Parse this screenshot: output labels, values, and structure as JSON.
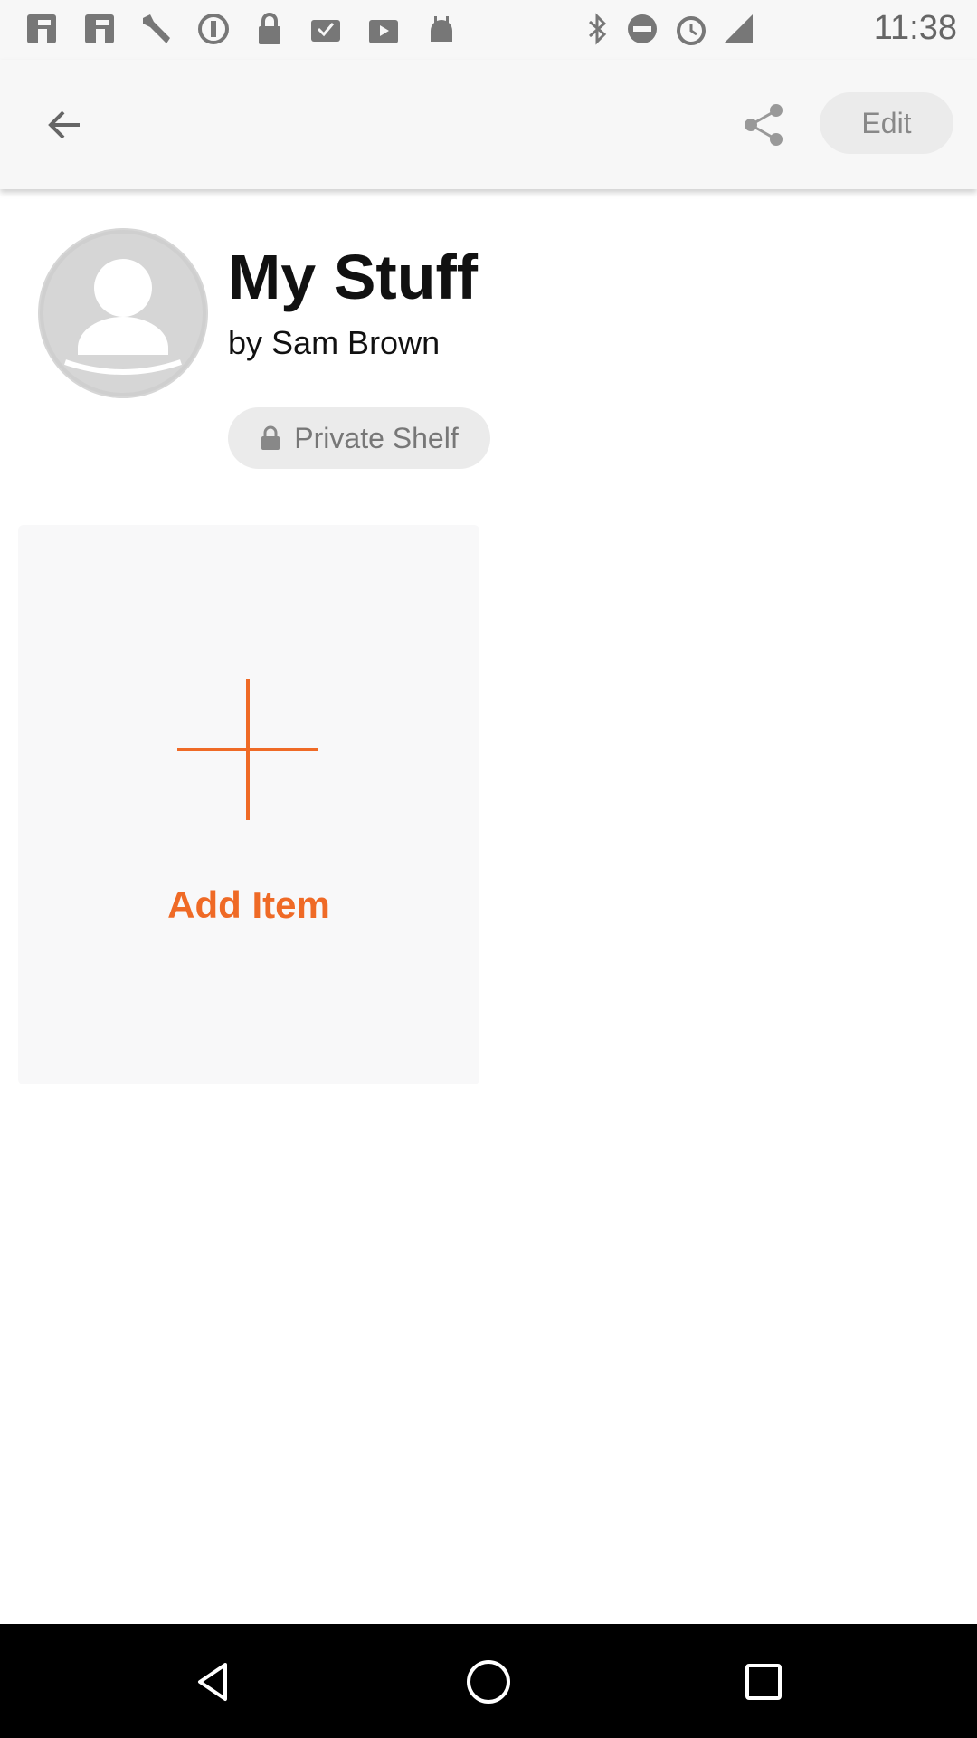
{
  "status_bar": {
    "time": "11:38",
    "left_icons": [
      "app-icon",
      "app-icon",
      "wrench-icon",
      "info-icon",
      "lock-icon",
      "inbox-icon",
      "play-store-icon",
      "android-icon"
    ],
    "right_icons": [
      "bluetooth-icon",
      "do-not-disturb-icon",
      "alarm-icon",
      "signal-icon"
    ]
  },
  "app_bar": {
    "edit_label": "Edit"
  },
  "shelf": {
    "title": "My Stuff",
    "by_label": "by",
    "owner": "Sam Brown",
    "privacy_label": "Private Shelf"
  },
  "add_card": {
    "label": "Add Item"
  },
  "colors": {
    "accent": "#ef6a26",
    "app_bar_bg": "#f7f7f7",
    "chip_bg": "#ebebeb",
    "card_bg": "#f8f8f9"
  }
}
